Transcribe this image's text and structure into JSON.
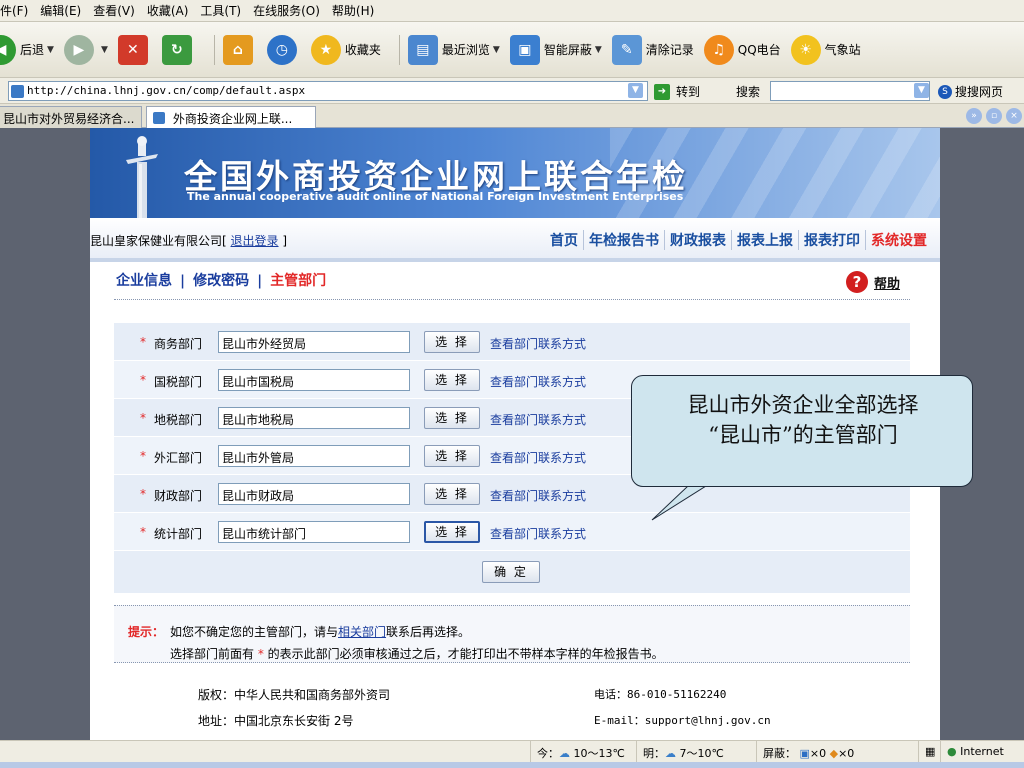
{
  "browser": {
    "menu": [
      "件(F)",
      "编辑(E)",
      "查看(V)",
      "收藏(A)",
      "工具(T)",
      "在线服务(O)",
      "帮助(H)"
    ],
    "toolbar": {
      "back": "后退",
      "favorites": "收藏夹",
      "recent": "最近浏览",
      "smart_block": "智能屏蔽",
      "clear_history": "清除记录",
      "qq_radio": "QQ电台",
      "weather": "气象站"
    },
    "address": "http://china.lhnj.gov.cn/comp/default.aspx",
    "goto": "转到",
    "search_label": "搜索",
    "sougou": "搜搜网页",
    "tabs": [
      "昆山市对外贸易经济合...",
      "外商投资企业网上联..."
    ]
  },
  "banner": {
    "title": "全国外商投资企业网上联合年检",
    "subtitle": "The annual cooperative audit online  of National Foreign Investment Enterprises"
  },
  "header": {
    "company": "昆山皇家保健业有限公司[",
    "logout": "退出登录",
    "company_end": "]",
    "nav": [
      "首页",
      "年检报告书",
      "财政报表",
      "报表上报",
      "报表打印",
      "系统设置"
    ]
  },
  "subnav": {
    "items": [
      "企业信息",
      "修改密码",
      "主管部门"
    ],
    "separator": "|",
    "help": "帮助"
  },
  "form": {
    "star": "*",
    "select_label": "选 择",
    "contact_link": "查看部门联系方式",
    "rows": [
      {
        "label": "商务部门",
        "value": "昆山市外经贸局"
      },
      {
        "label": "国税部门",
        "value": "昆山市国税局"
      },
      {
        "label": "地税部门",
        "value": "昆山市地税局"
      },
      {
        "label": "外汇部门",
        "value": "昆山市外管局"
      },
      {
        "label": "财政部门",
        "value": "昆山市财政局"
      },
      {
        "label": "统计部门",
        "value": "昆山市统计部门"
      }
    ],
    "confirm": "确 定"
  },
  "tips": {
    "label": "提示：",
    "line1_a": "如您不确定您的主管部门，请与",
    "line1_link": "相关部门",
    "line1_b": "联系后再选择。",
    "line2_a": "选择部门前面有",
    "line2_star": "*",
    "line2_b": "的表示此部门必须审核通过之后，才能打印出不带样本字样的年检报告书。"
  },
  "footer": {
    "copyright": "版权：中华人民共和国商务部外资司",
    "phone": "电话：86-010-51162240",
    "address": "地址：中国北京东长安街 2号",
    "email": "E-mail：support@lhnj.gov.cn"
  },
  "callout": {
    "line1": "昆山市外资企业全部选择",
    "line2": "“昆山市”的主管部门"
  },
  "status": {
    "today": "今：",
    "today_temp": "10～13℃",
    "tomorrow": "明：",
    "tomorrow_temp": "7～10℃",
    "block": "屏蔽：",
    "count1": "×0",
    "count2": "×0",
    "zone": "Internet"
  },
  "colors": {
    "accent_blue": "#1a4fa0",
    "active_red": "#e22828",
    "callout_bg": "#cfe5ee"
  }
}
